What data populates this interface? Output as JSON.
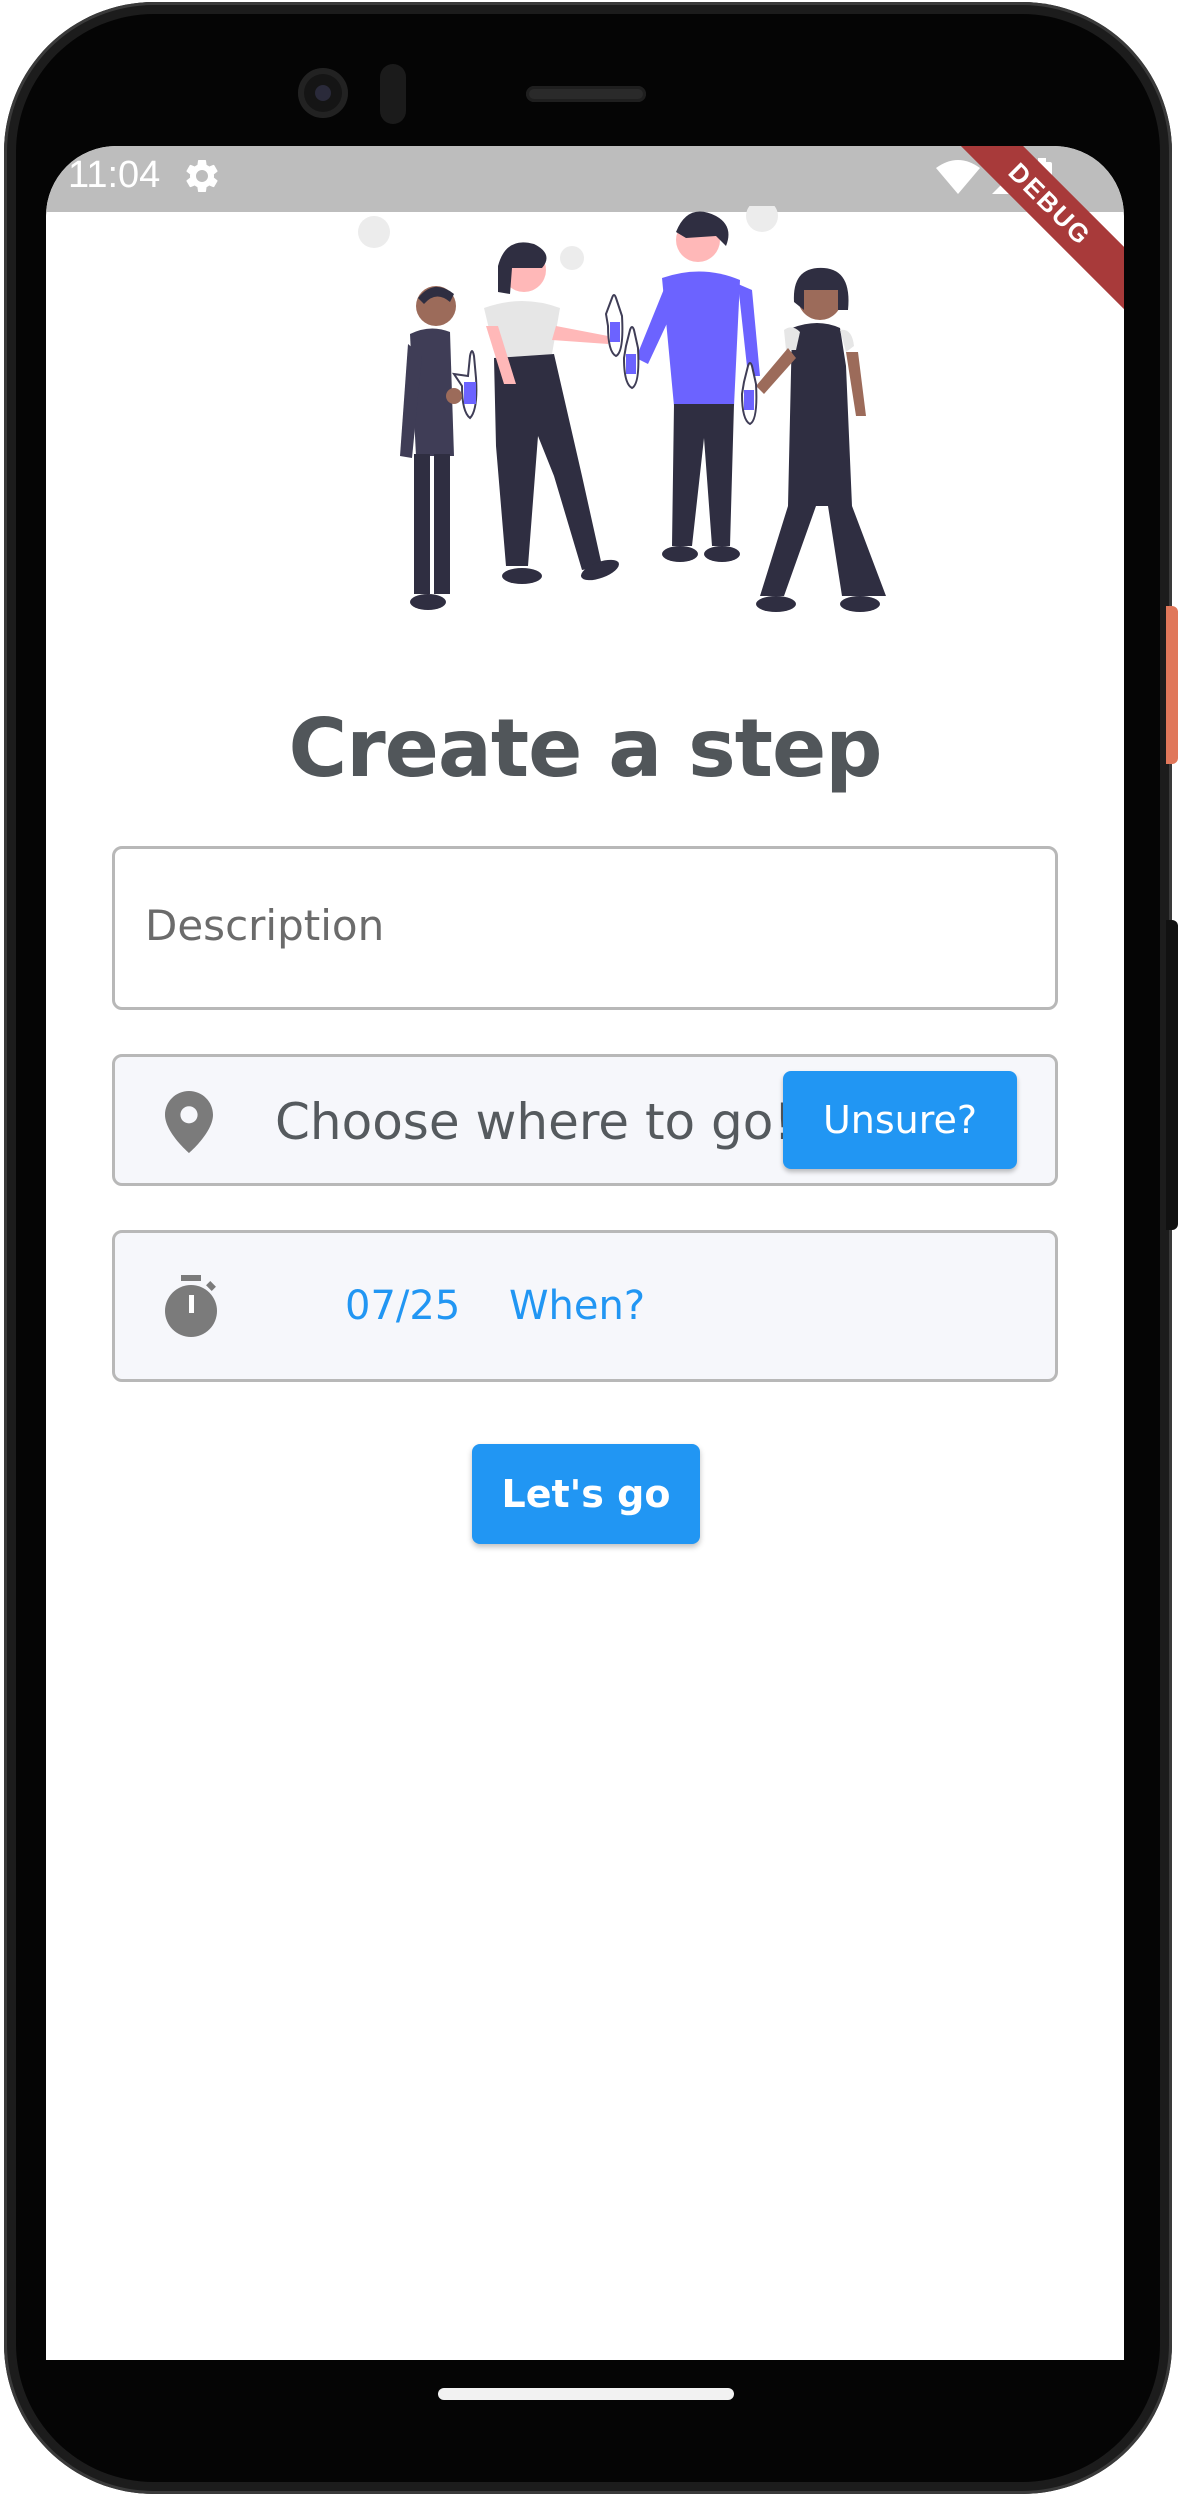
{
  "status_bar": {
    "time": "11:04",
    "debug_label": "DEBUG"
  },
  "page": {
    "title": "Create a step"
  },
  "form": {
    "description_placeholder": "Description",
    "where_label": "Choose where to go!",
    "unsure_label": "Unsure?",
    "date_value": "07/25",
    "when_label": "When?",
    "submit_label": "Let's go"
  },
  "icons": {
    "status_settings": "gear-icon",
    "status_wifi": "wifi-icon",
    "status_signal": "signal-icon",
    "status_battery": "battery-icon",
    "location": "location-pin-icon",
    "timer": "timer-icon"
  },
  "colors": {
    "accent": "#2196f3",
    "title": "#51565a",
    "status_bar": "#bdbdbd",
    "debug_banner": "#a83a3a",
    "illustration_accent": "#6c63ff"
  }
}
